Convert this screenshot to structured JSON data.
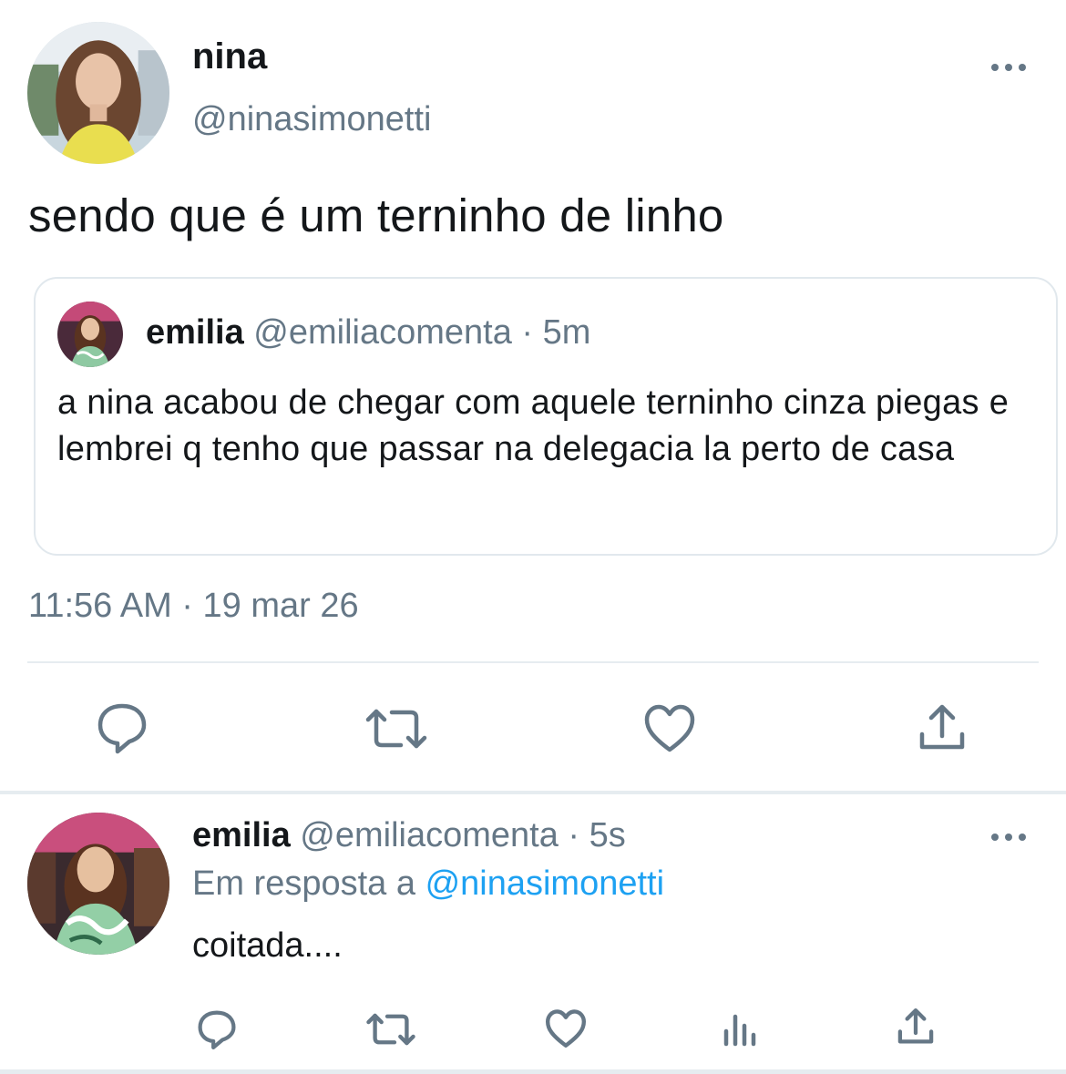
{
  "main_tweet": {
    "display_name": "nina",
    "handle": "@ninasimonetti",
    "text": "sendo que é um terninho de linho",
    "timestamp": "11:56 AM · 19 mar 26",
    "more_icon": "more-horizontal-icon",
    "actions": [
      "reply-icon",
      "retweet-icon",
      "like-icon",
      "share-icon"
    ]
  },
  "quoted_tweet": {
    "display_name": "emilia",
    "handle": "@emiliacomenta",
    "meta": "@emiliacomenta · 5m",
    "text": "a nina acabou de chegar com aquele terninho cinza piegas e lembrei q tenho que passar na delegacia la perto de casa"
  },
  "reply_tweet": {
    "display_name": "emilia",
    "meta": "@emiliacomenta · 5s",
    "reply_prefix": "Em resposta a ",
    "reply_mention": "@ninasimonetti",
    "text": "coitada....",
    "more_icon": "more-horizontal-icon",
    "actions": [
      "reply-icon",
      "retweet-icon",
      "like-icon",
      "analytics-icon",
      "share-icon"
    ]
  },
  "colors": {
    "text_primary": "#14171a",
    "text_secondary": "#657786",
    "link": "#1da1f2",
    "border": "#e1e8ed"
  }
}
